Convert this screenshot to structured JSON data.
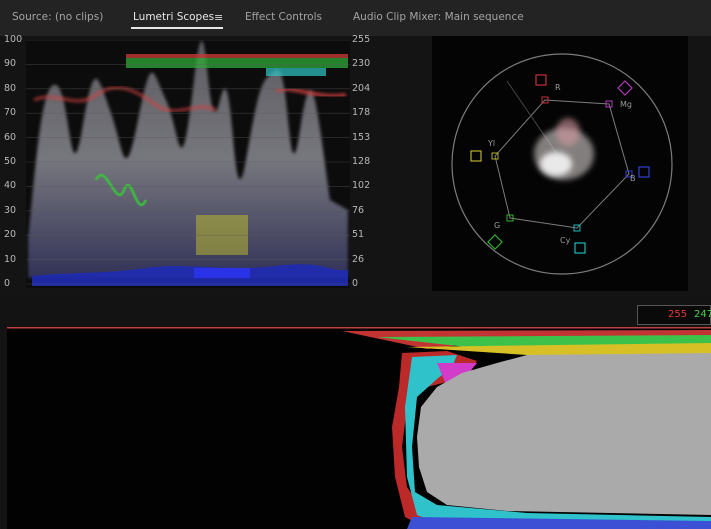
{
  "tabs": [
    {
      "label": "Source: (no clips)",
      "active": false
    },
    {
      "label": "Lumetri Scopes",
      "active": true
    },
    {
      "label": "Effect Controls",
      "active": false
    },
    {
      "label": "Audio Clip Mixer: Main sequence",
      "active": false
    }
  ],
  "menu_icon": "hamburger-menu-icon",
  "waveform": {
    "left_scale": [
      "100",
      "90",
      "80",
      "70",
      "60",
      "50",
      "40",
      "30",
      "20",
      "10",
      "0"
    ],
    "right_scale": [
      "255",
      "230",
      "204",
      "178",
      "153",
      "128",
      "102",
      "76",
      "51",
      "26",
      "0"
    ]
  },
  "vectorscope": {
    "targets": [
      {
        "label": "R",
        "color": "#c0303a"
      },
      {
        "label": "Mg",
        "color": "#b03ab8"
      },
      {
        "label": "B",
        "color": "#3040d0"
      },
      {
        "label": "Cy",
        "color": "#20b8b8"
      },
      {
        "label": "G",
        "color": "#30b030"
      },
      {
        "label": "Yl",
        "color": "#b8b030"
      }
    ]
  },
  "histogram": {
    "readout": {
      "red": "255",
      "green": "247"
    },
    "colors": {
      "red": "#e23b3b",
      "green": "#46d24a",
      "yellow": "#d8c22a",
      "gray": "#a9a9a9",
      "blue": "#3d4fd4",
      "cyan": "#2fc6cf",
      "magenta": "#d33cc9"
    }
  }
}
